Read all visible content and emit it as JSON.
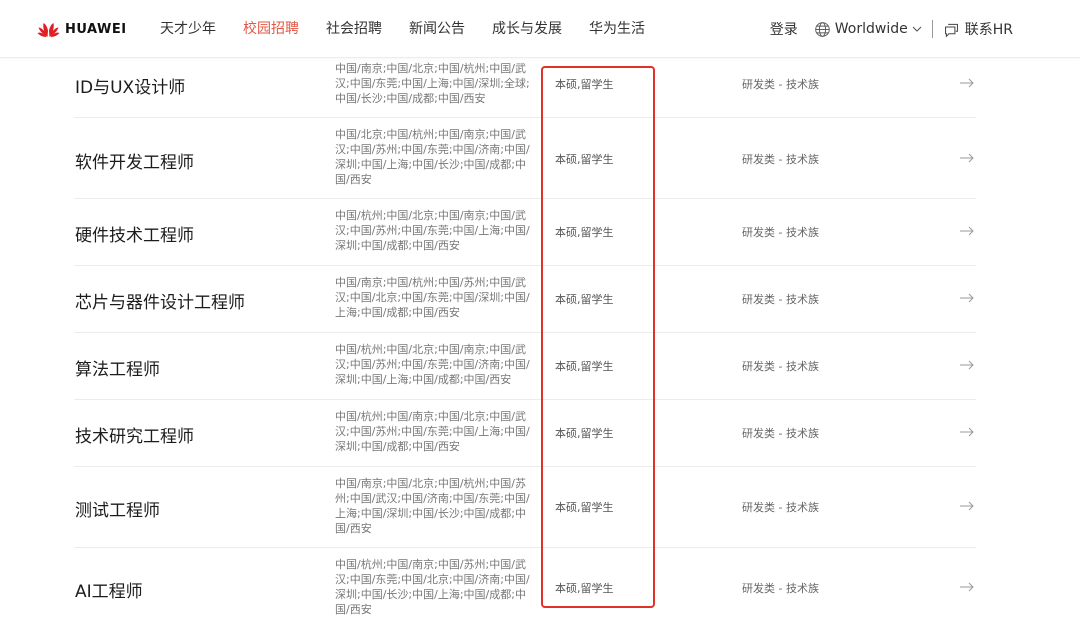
{
  "header": {
    "logo_text": "HUAWEI",
    "nav": [
      {
        "label": "天才少年",
        "active": false
      },
      {
        "label": "校园招聘",
        "active": true
      },
      {
        "label": "社会招聘",
        "active": false
      },
      {
        "label": "新闻公告",
        "active": false
      },
      {
        "label": "成长与发展",
        "active": false
      },
      {
        "label": "华为生活",
        "active": false
      }
    ],
    "login_label": "登录",
    "region_label": "Worldwide",
    "contact_label": "联系HR"
  },
  "colors": {
    "accent": "#e45745",
    "highlight_border": "#e0322b",
    "logo_red": "#e11e25"
  },
  "jobs": [
    {
      "title": "ID与UX设计师",
      "locations": "中国/南京;中国/北京;中国/杭州;中国/武汉;中国/东莞;中国/上海;中国/深圳;全球;中国/长沙;中国/成都;中国/西安",
      "degree": "本硕,留学生",
      "category": "研发类 - 技术族"
    },
    {
      "title": "软件开发工程师",
      "locations": "中国/北京;中国/杭州;中国/南京;中国/武汉;中国/苏州;中国/东莞;中国/济南;中国/深圳;中国/上海;中国/长沙;中国/成都;中国/西安",
      "degree": "本硕,留学生",
      "category": "研发类 - 技术族"
    },
    {
      "title": "硬件技术工程师",
      "locations": "中国/杭州;中国/北京;中国/南京;中国/武汉;中国/苏州;中国/东莞;中国/上海;中国/深圳;中国/成都;中国/西安",
      "degree": "本硕,留学生",
      "category": "研发类 - 技术族"
    },
    {
      "title": "芯片与器件设计工程师",
      "locations": "中国/南京;中国/杭州;中国/苏州;中国/武汉;中国/北京;中国/东莞;中国/深圳;中国/上海;中国/成都;中国/西安",
      "degree": "本硕,留学生",
      "category": "研发类 - 技术族"
    },
    {
      "title": "算法工程师",
      "locations": "中国/杭州;中国/北京;中国/南京;中国/武汉;中国/苏州;中国/东莞;中国/济南;中国/深圳;中国/上海;中国/成都;中国/西安",
      "degree": "本硕,留学生",
      "category": "研发类 - 技术族"
    },
    {
      "title": "技术研究工程师",
      "locations": "中国/杭州;中国/南京;中国/北京;中国/武汉;中国/苏州;中国/东莞;中国/上海;中国/深圳;中国/成都;中国/西安",
      "degree": "本硕,留学生",
      "category": "研发类 - 技术族"
    },
    {
      "title": "测试工程师",
      "locations": "中国/南京;中国/北京;中国/杭州;中国/苏州;中国/武汉;中国/济南;中国/东莞;中国/上海;中国/深圳;中国/长沙;中国/成都;中国/西安",
      "degree": "本硕,留学生",
      "category": "研发类 - 技术族"
    },
    {
      "title": "AI工程师",
      "locations": "中国/杭州;中国/南京;中国/苏州;中国/武汉;中国/东莞;中国/北京;中国/济南;中国/深圳;中国/长沙;中国/上海;中国/成都;中国/西安",
      "degree": "本硕,留学生",
      "category": "研发类 - 技术族"
    }
  ]
}
